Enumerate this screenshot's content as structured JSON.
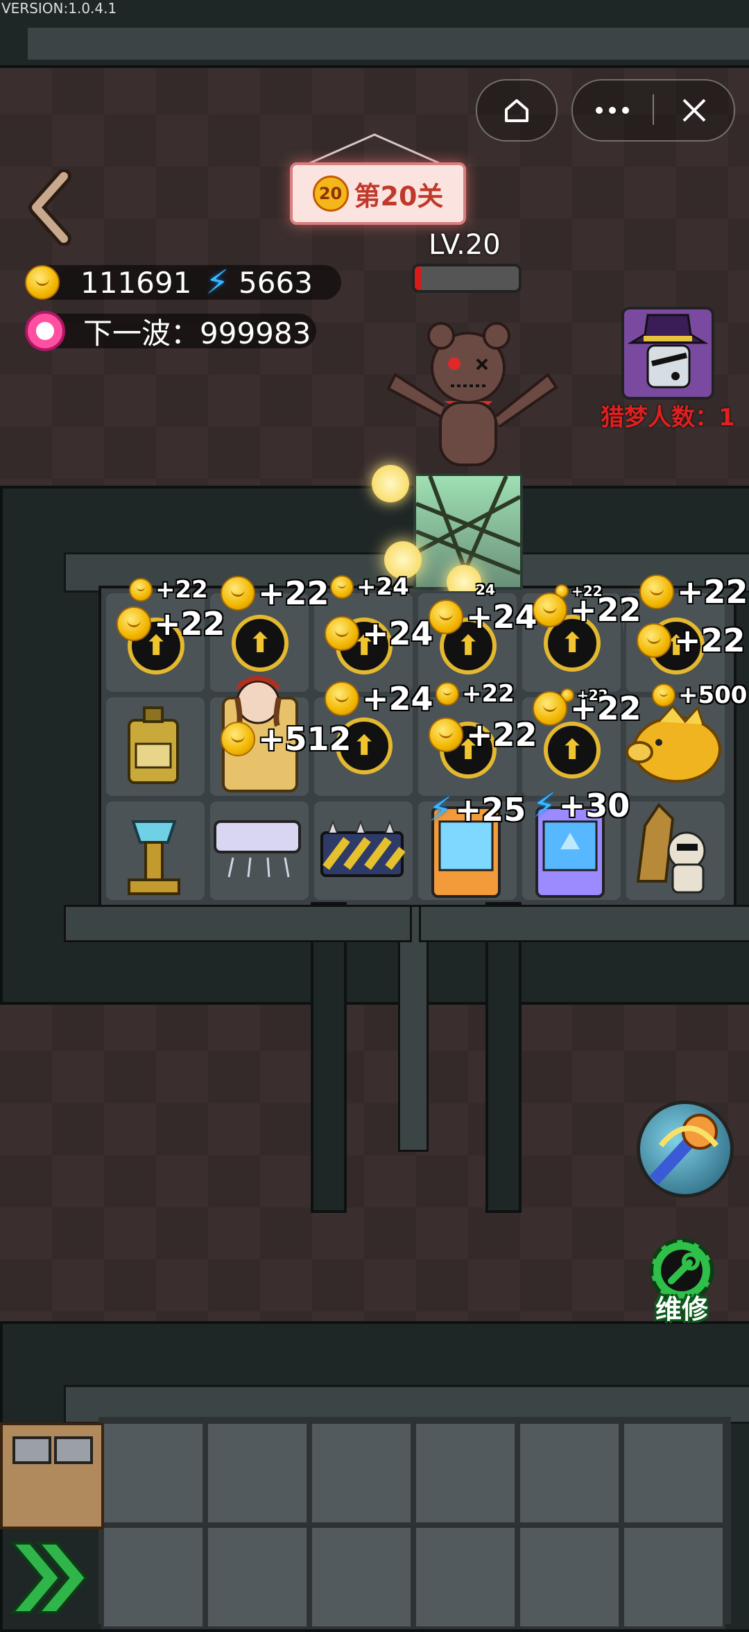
{
  "version": "VERSION:1.0.4.1",
  "capsule": {
    "home_icon": "home-icon",
    "more_icon": "more-icon",
    "close_icon": "close-icon"
  },
  "header": {
    "back_icon": "back-arrow-icon",
    "level_badge": "20",
    "level_title": "第20关"
  },
  "resources": {
    "coins": "111691",
    "energy": "5663",
    "next_wave_label": "下一波：999983"
  },
  "enemy": {
    "level": "LV.20",
    "hp_fraction": 0.06
  },
  "hunter": {
    "label": "猎梦人数：1"
  },
  "grid": {
    "row1": [
      {
        "top": "+22",
        "main": "+22"
      },
      {
        "main": "+22"
      },
      {
        "top": "+24",
        "main": "+24"
      },
      {
        "top": "24",
        "main": "+24"
      },
      {
        "top": "+22",
        "main": "+22"
      },
      {
        "top": "+22",
        "main": "+22"
      }
    ],
    "row2": [
      {
        "item": "fuel-can"
      },
      {
        "main": "+512",
        "item": "sleeping-girl-bed"
      },
      {
        "main": "+24"
      },
      {
        "top": "+22",
        "main": "+22"
      },
      {
        "top": "+22",
        "main": "+22",
        "tiny": "+22"
      },
      {
        "top": "+500",
        "item": "golden-piggy-bank"
      }
    ],
    "row3": [
      {
        "item": "crystal-pedestal"
      },
      {
        "item": "air-conditioner"
      },
      {
        "item": "spike-trap"
      },
      {
        "main": "+25",
        "item": "vending-machine-orange"
      },
      {
        "main": "+30",
        "item": "vending-machine-blue"
      },
      {
        "item": "lucky-cat-statue"
      }
    ]
  },
  "actions": {
    "skill_icon": "hammer-skill-icon",
    "repair_label": "维修"
  },
  "colors": {
    "accent_gold": "#f2b600",
    "energy_blue": "#39b9ff",
    "hunter_red": "#e02020",
    "repair_green": "#2fc04a"
  }
}
